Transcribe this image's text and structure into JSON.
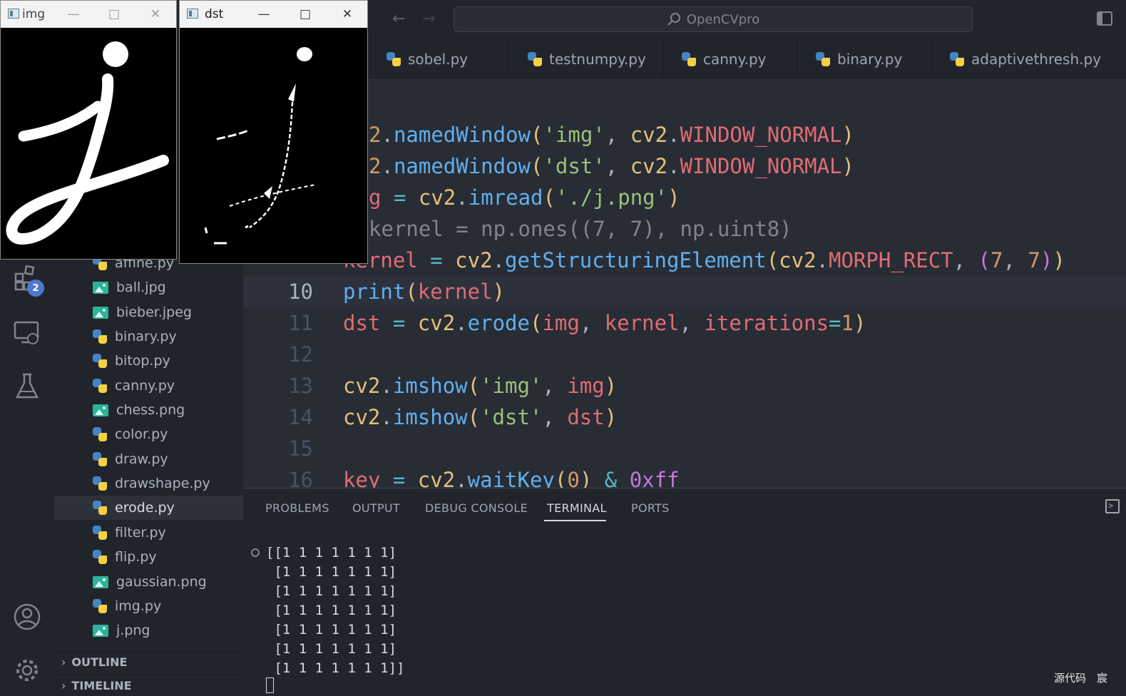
{
  "titlebar": {
    "back_icon": "arrow-left-icon",
    "forward_icon": "arrow-right-icon",
    "search_text": "OpenCVpro"
  },
  "tabs": [
    {
      "label": "sobel.py",
      "icon": "python-file-icon"
    },
    {
      "label": "testnumpy.py",
      "icon": "python-file-icon"
    },
    {
      "label": "canny.py",
      "icon": "python-file-icon"
    },
    {
      "label": "binary.py",
      "icon": "python-file-icon"
    },
    {
      "label": "adaptivethresh.py",
      "icon": "python-file-icon"
    }
  ],
  "activity_bar": {
    "extensions_badge": "2"
  },
  "explorer": {
    "files": [
      {
        "label": "affine.py",
        "type": "py"
      },
      {
        "label": "ball.jpg",
        "type": "img"
      },
      {
        "label": "bieber.jpeg",
        "type": "img"
      },
      {
        "label": "binary.py",
        "type": "py"
      },
      {
        "label": "bitop.py",
        "type": "py"
      },
      {
        "label": "canny.py",
        "type": "py"
      },
      {
        "label": "chess.png",
        "type": "img"
      },
      {
        "label": "color.py",
        "type": "py"
      },
      {
        "label": "draw.py",
        "type": "py"
      },
      {
        "label": "drawshape.py",
        "type": "py"
      },
      {
        "label": "erode.py",
        "type": "py",
        "active": true
      },
      {
        "label": "filter.py",
        "type": "py"
      },
      {
        "label": "flip.py",
        "type": "py"
      },
      {
        "label": "gaussian.png",
        "type": "img"
      },
      {
        "label": "img.py",
        "type": "py"
      },
      {
        "label": "j.png",
        "type": "img"
      }
    ],
    "outline_label": "OUTLINE",
    "timeline_label": "TIMELINE"
  },
  "editor": {
    "line_numbers": [
      "",
      "",
      "",
      "",
      "",
      "10",
      "11",
      "12",
      "13",
      "14",
      "15",
      "16"
    ],
    "lines": [
      "2.namedWindow('img', cv2.WINDOW_NORMAL)",
      "2.namedWindow('dst', cv2.WINDOW_NORMAL)",
      "g = cv2.imread('./j.png')",
      "kernel = np.ones((7, 7), np.uint8)",
      "kernel = cv2.getStructuringElement(cv2.MORPH_RECT, (7, 7))",
      "print(kernel)",
      "dst = cv2.erode(img, kernel, iterations=1)",
      "",
      "cv2.imshow('img', img)",
      "cv2.imshow('dst', dst)",
      "",
      "key = cv2.waitKey(0) & 0xff"
    ],
    "current_line": "10"
  },
  "panel": {
    "tabs": [
      "PROBLEMS",
      "OUTPUT",
      "DEBUG CONSOLE",
      "TERMINAL",
      "PORTS"
    ],
    "active_tab": "TERMINAL",
    "terminal_lines": [
      "[[1 1 1 1 1 1 1]",
      " [1 1 1 1 1 1 1]",
      " [1 1 1 1 1 1 1]",
      " [1 1 1 1 1 1 1]",
      " [1 1 1 1 1 1 1]",
      " [1 1 1 1 1 1 1]",
      " [1 1 1 1 1 1 1]]"
    ]
  },
  "windows": {
    "img": {
      "title": "img"
    },
    "dst": {
      "title": "dst"
    }
  },
  "watermark": "源代码　宸",
  "colors": {
    "accent": "#4d78cc",
    "keyword_red": "#e06c75",
    "function_blue": "#61afef",
    "string_green": "#98c379",
    "class_yellow": "#e5c07b",
    "number_orange": "#d19a66"
  }
}
